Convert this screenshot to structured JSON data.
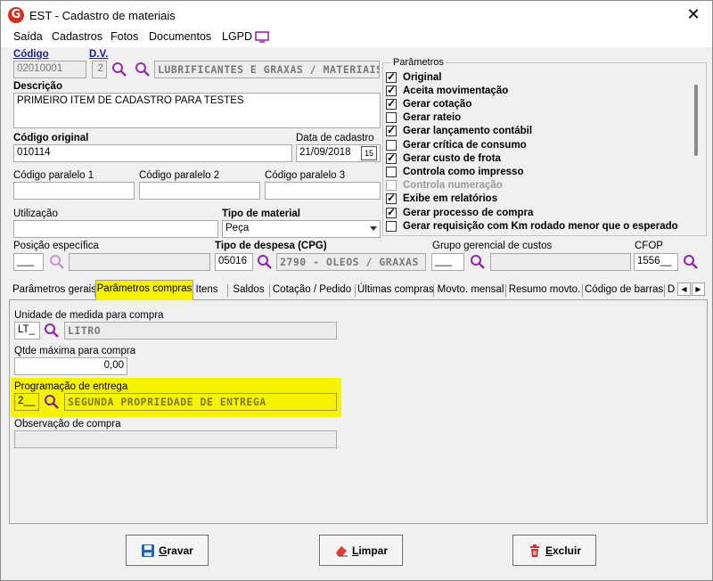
{
  "window": {
    "title": "EST - Cadastro de materiais",
    "logo": "G",
    "close": "✕"
  },
  "menu": {
    "items": [
      "Saída",
      "Cadastros",
      "Fotos",
      "Documentos",
      "LGPD"
    ]
  },
  "form": {
    "codigo_label": "Código",
    "codigo_value": "02010001",
    "dv_label": "D.V.",
    "dv_value": "2",
    "categoria_value": "LUBRIFICANTES E GRAXAS / MATERIAIS",
    "descricao_label": "Descrição",
    "descricao_value": "PRIMEIRO ITEM DE CADASTRO PARA TESTES",
    "codigo_original_label": "Código original",
    "codigo_original_value": "010114",
    "data_cadastro_label": "Data de cadastro",
    "data_cadastro_value": "21/09/2018",
    "calendar_label": "15",
    "codigo_paralelo_1_label": "Código paralelo 1",
    "codigo_paralelo_2_label": "Código paralelo 2",
    "codigo_paralelo_3_label": "Código paralelo 3",
    "utilizacao_label": "Utilização",
    "tipo_material_label": "Tipo de material",
    "tipo_material_value": "Peça",
    "posicao_especifica_label": "Posição específica",
    "posicao_especifica_value": "___",
    "tipo_despesa_label": "Tipo de despesa (CPG)",
    "tipo_despesa_code": "05016",
    "tipo_despesa_desc": "2790 - OLEOS / GRAXAS / L",
    "grupo_gerencial_label": "Grupo gerencial de custos",
    "grupo_gerencial_value": "___",
    "cfop_label": "CFOP",
    "cfop_value": "1556__"
  },
  "parametros": {
    "title": "Parâmetros",
    "items": [
      {
        "label": "Original",
        "checked": true,
        "enabled": true
      },
      {
        "label": "Aceita movimentação",
        "checked": true,
        "enabled": true
      },
      {
        "label": "Gerar cotação",
        "checked": true,
        "enabled": true
      },
      {
        "label": "Gerar rateio",
        "checked": false,
        "enabled": true
      },
      {
        "label": "Gerar lançamento contábil",
        "checked": true,
        "enabled": true
      },
      {
        "label": "Gerar crítica de consumo",
        "checked": false,
        "enabled": true
      },
      {
        "label": "Gerar custo de frota",
        "checked": true,
        "enabled": true
      },
      {
        "label": "Controla como impresso",
        "checked": false,
        "enabled": true
      },
      {
        "label": "Controla numeração",
        "checked": false,
        "enabled": false
      },
      {
        "label": "Exibe em relatórios",
        "checked": true,
        "enabled": true
      },
      {
        "label": "Gerar processo de compra",
        "checked": true,
        "enabled": true
      },
      {
        "label": "Gerar requisição com Km rodado menor que o esperado",
        "checked": false,
        "enabled": true
      }
    ]
  },
  "tabs": {
    "items": [
      "Parâmetros gerais",
      "Parâmetros compras",
      "Itens",
      "Saldos",
      "Cotação / Pedido",
      "Últimas compras",
      "Movto. mensal",
      "Resumo movto.",
      "Código de barras",
      "D"
    ],
    "active": "Parâmetros compras",
    "prev": "◀",
    "next": "▶"
  },
  "compras": {
    "unidade_label": "Unidade de medida para compra",
    "unidade_code": "LT_",
    "unidade_desc": "LITRO",
    "qtde_label": "Qtde máxima para compra",
    "qtde_value": "0,00",
    "programacao_label": "Programação de entrega",
    "programacao_code": "2__",
    "programacao_desc": "SEGUNDA PROPRIEDADE DE ENTREGA",
    "observacao_label": "Observação de compra",
    "observacao_value": ""
  },
  "buttons": {
    "gravar_first": "G",
    "gravar_rest": "ravar",
    "limpar_first": "L",
    "limpar_rest": "impar",
    "excluir_first": "E",
    "excluir_rest": "xcluir"
  },
  "colors": {
    "highlight": "#f7f300",
    "search_icon": "#8e24aa",
    "label_blue": "#1a237e"
  }
}
